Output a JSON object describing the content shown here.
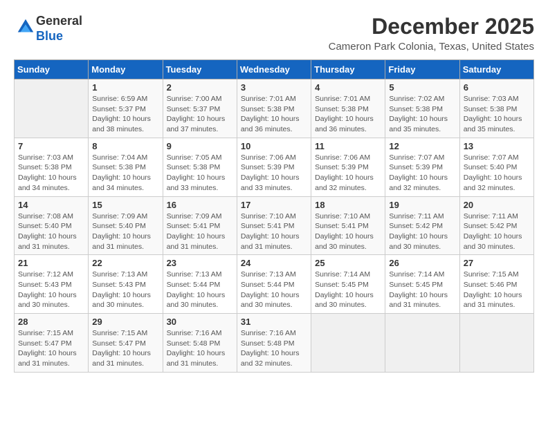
{
  "header": {
    "logo_line1": "General",
    "logo_line2": "Blue",
    "title": "December 2025",
    "subtitle": "Cameron Park Colonia, Texas, United States"
  },
  "weekdays": [
    "Sunday",
    "Monday",
    "Tuesday",
    "Wednesday",
    "Thursday",
    "Friday",
    "Saturday"
  ],
  "weeks": [
    [
      {
        "num": "",
        "info": ""
      },
      {
        "num": "1",
        "info": "Sunrise: 6:59 AM\nSunset: 5:37 PM\nDaylight: 10 hours\nand 38 minutes."
      },
      {
        "num": "2",
        "info": "Sunrise: 7:00 AM\nSunset: 5:37 PM\nDaylight: 10 hours\nand 37 minutes."
      },
      {
        "num": "3",
        "info": "Sunrise: 7:01 AM\nSunset: 5:38 PM\nDaylight: 10 hours\nand 36 minutes."
      },
      {
        "num": "4",
        "info": "Sunrise: 7:01 AM\nSunset: 5:38 PM\nDaylight: 10 hours\nand 36 minutes."
      },
      {
        "num": "5",
        "info": "Sunrise: 7:02 AM\nSunset: 5:38 PM\nDaylight: 10 hours\nand 35 minutes."
      },
      {
        "num": "6",
        "info": "Sunrise: 7:03 AM\nSunset: 5:38 PM\nDaylight: 10 hours\nand 35 minutes."
      }
    ],
    [
      {
        "num": "7",
        "info": "Sunrise: 7:03 AM\nSunset: 5:38 PM\nDaylight: 10 hours\nand 34 minutes."
      },
      {
        "num": "8",
        "info": "Sunrise: 7:04 AM\nSunset: 5:38 PM\nDaylight: 10 hours\nand 34 minutes."
      },
      {
        "num": "9",
        "info": "Sunrise: 7:05 AM\nSunset: 5:38 PM\nDaylight: 10 hours\nand 33 minutes."
      },
      {
        "num": "10",
        "info": "Sunrise: 7:06 AM\nSunset: 5:39 PM\nDaylight: 10 hours\nand 33 minutes."
      },
      {
        "num": "11",
        "info": "Sunrise: 7:06 AM\nSunset: 5:39 PM\nDaylight: 10 hours\nand 32 minutes."
      },
      {
        "num": "12",
        "info": "Sunrise: 7:07 AM\nSunset: 5:39 PM\nDaylight: 10 hours\nand 32 minutes."
      },
      {
        "num": "13",
        "info": "Sunrise: 7:07 AM\nSunset: 5:40 PM\nDaylight: 10 hours\nand 32 minutes."
      }
    ],
    [
      {
        "num": "14",
        "info": "Sunrise: 7:08 AM\nSunset: 5:40 PM\nDaylight: 10 hours\nand 31 minutes."
      },
      {
        "num": "15",
        "info": "Sunrise: 7:09 AM\nSunset: 5:40 PM\nDaylight: 10 hours\nand 31 minutes."
      },
      {
        "num": "16",
        "info": "Sunrise: 7:09 AM\nSunset: 5:41 PM\nDaylight: 10 hours\nand 31 minutes."
      },
      {
        "num": "17",
        "info": "Sunrise: 7:10 AM\nSunset: 5:41 PM\nDaylight: 10 hours\nand 31 minutes."
      },
      {
        "num": "18",
        "info": "Sunrise: 7:10 AM\nSunset: 5:41 PM\nDaylight: 10 hours\nand 30 minutes."
      },
      {
        "num": "19",
        "info": "Sunrise: 7:11 AM\nSunset: 5:42 PM\nDaylight: 10 hours\nand 30 minutes."
      },
      {
        "num": "20",
        "info": "Sunrise: 7:11 AM\nSunset: 5:42 PM\nDaylight: 10 hours\nand 30 minutes."
      }
    ],
    [
      {
        "num": "21",
        "info": "Sunrise: 7:12 AM\nSunset: 5:43 PM\nDaylight: 10 hours\nand 30 minutes."
      },
      {
        "num": "22",
        "info": "Sunrise: 7:13 AM\nSunset: 5:43 PM\nDaylight: 10 hours\nand 30 minutes."
      },
      {
        "num": "23",
        "info": "Sunrise: 7:13 AM\nSunset: 5:44 PM\nDaylight: 10 hours\nand 30 minutes."
      },
      {
        "num": "24",
        "info": "Sunrise: 7:13 AM\nSunset: 5:44 PM\nDaylight: 10 hours\nand 30 minutes."
      },
      {
        "num": "25",
        "info": "Sunrise: 7:14 AM\nSunset: 5:45 PM\nDaylight: 10 hours\nand 30 minutes."
      },
      {
        "num": "26",
        "info": "Sunrise: 7:14 AM\nSunset: 5:45 PM\nDaylight: 10 hours\nand 31 minutes."
      },
      {
        "num": "27",
        "info": "Sunrise: 7:15 AM\nSunset: 5:46 PM\nDaylight: 10 hours\nand 31 minutes."
      }
    ],
    [
      {
        "num": "28",
        "info": "Sunrise: 7:15 AM\nSunset: 5:47 PM\nDaylight: 10 hours\nand 31 minutes."
      },
      {
        "num": "29",
        "info": "Sunrise: 7:15 AM\nSunset: 5:47 PM\nDaylight: 10 hours\nand 31 minutes."
      },
      {
        "num": "30",
        "info": "Sunrise: 7:16 AM\nSunset: 5:48 PM\nDaylight: 10 hours\nand 31 minutes."
      },
      {
        "num": "31",
        "info": "Sunrise: 7:16 AM\nSunset: 5:48 PM\nDaylight: 10 hours\nand 32 minutes."
      },
      {
        "num": "",
        "info": ""
      },
      {
        "num": "",
        "info": ""
      },
      {
        "num": "",
        "info": ""
      }
    ]
  ]
}
